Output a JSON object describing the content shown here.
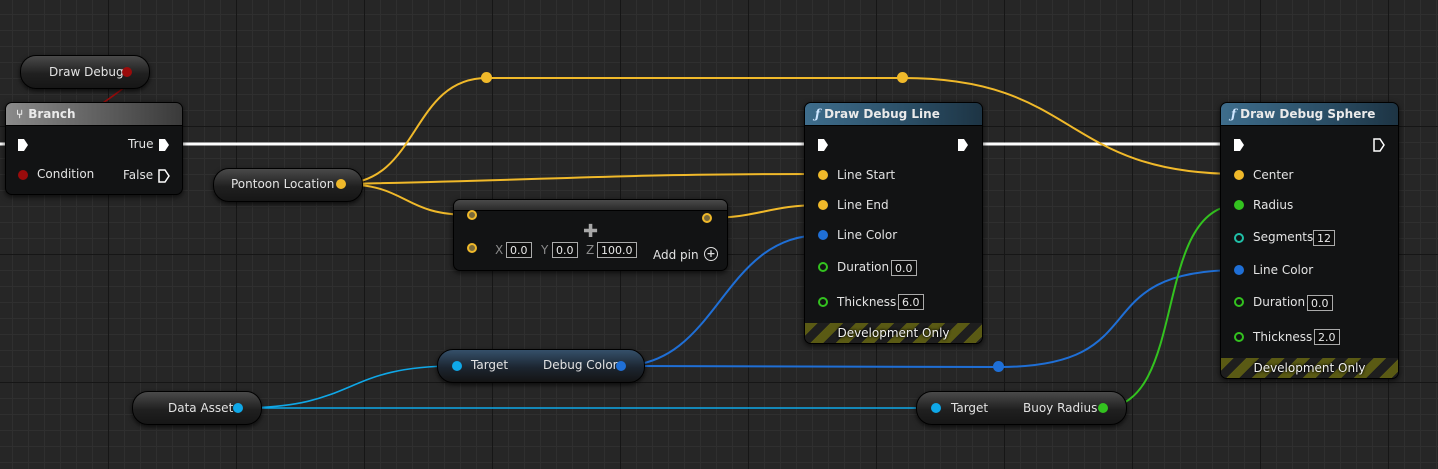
{
  "colors": {
    "exec": "#ffffff",
    "vector": "#f0b92a",
    "color_struct": "#1f6fd6",
    "float": "#33c21f",
    "object": "#0fa8e8",
    "bool": "#9a0b0b"
  },
  "draw_debug_var": {
    "label": "Draw Debug"
  },
  "branch": {
    "title": "Branch",
    "icon": "branch-icon",
    "condition": "Condition",
    "true_label": "True",
    "false_label": "False"
  },
  "pontoon_var": {
    "label": "Pontoon Location"
  },
  "make_vector": {
    "x_label": "X",
    "x_value": "0.0",
    "y_label": "Y",
    "y_value": "0.0",
    "z_label": "Z",
    "z_value": "100.0",
    "add_pin": "Add pin"
  },
  "draw_line": {
    "title": "Draw Debug Line",
    "icon": "function-icon",
    "line_start": "Line Start",
    "line_end": "Line End",
    "line_color": "Line Color",
    "duration": "Duration",
    "duration_value": "0.0",
    "thickness": "Thickness",
    "thickness_value": "6.0",
    "footer": "Development Only"
  },
  "draw_sphere": {
    "title": "Draw Debug Sphere",
    "icon": "function-icon",
    "center": "Center",
    "radius": "Radius",
    "segments": "Segments",
    "segments_value": "12",
    "line_color": "Line Color",
    "duration": "Duration",
    "duration_value": "0.0",
    "thickness": "Thickness",
    "thickness_value": "2.0",
    "footer": "Development Only"
  },
  "debug_color_get": {
    "target": "Target",
    "output": "Debug Color"
  },
  "data_asset_var": {
    "label": "Data Asset"
  },
  "buoy_radius_get": {
    "target": "Target",
    "output": "Buoy Radius"
  }
}
